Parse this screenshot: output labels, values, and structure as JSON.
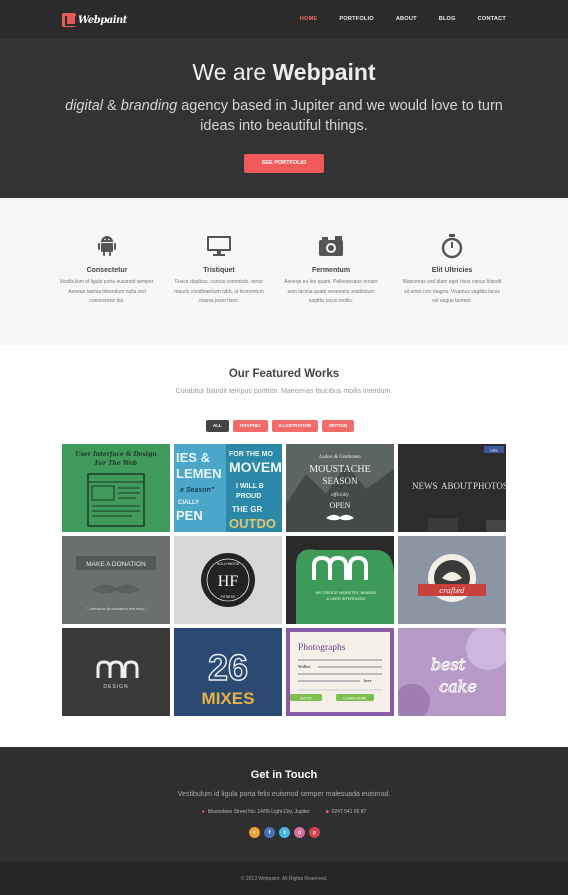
{
  "nav": {
    "logo_text": "Webpaint",
    "items": [
      {
        "label": "HOME",
        "active": true
      },
      {
        "label": "PORTFOLIO",
        "active": false
      },
      {
        "label": "ABOUT",
        "active": false
      },
      {
        "label": "BLOG",
        "active": false
      },
      {
        "label": "CONTACT",
        "active": false
      }
    ]
  },
  "hero": {
    "title_prefix": "We are ",
    "title_brand": "Webpaint",
    "tag_italic1": "digital",
    "tag_amp": " & ",
    "tag_italic2": "branding",
    "tag_rest": " agency based in Jupiter and we would love to turn ideas into beautiful things.",
    "button": "SEE PORTFOLIO"
  },
  "features": [
    {
      "icon": "android-icon",
      "title": "Consectetur",
      "text": "Vestibulum id ligula porta euismod semper. Aenean lacinia bibendum nulla sed consectetur dui."
    },
    {
      "icon": "monitor-icon",
      "title": "Tristiquet",
      "text": "Fusce dapibus, cursus commodo, tortor mauris condimentum nibh, ut fermentum massa justo risus."
    },
    {
      "icon": "camera-icon",
      "title": "Fermentum",
      "text": "Aenean eu leo quam. Pellentesque ornare sem lacinia quam venenatis vestibulum sagittis lacus mollis."
    },
    {
      "icon": "stopwatch-icon",
      "title": "Elit Ultricies",
      "text": "Maecenas sed diam eget risus varius blandit sit amet non magna. Vivamus sagittis lacus vel augue laoreet."
    }
  ],
  "works": {
    "title": "Our Featured Works",
    "subtitle": "Curabitur blandit tempus porttitor. Maecenas faucibus mollis interdum.",
    "filters": [
      {
        "label": "ALL",
        "active": true
      },
      {
        "label": "GRAPHIC",
        "active": false
      },
      {
        "label": "ILLUSTRATION",
        "active": false
      },
      {
        "label": "MOTION",
        "active": false
      }
    ],
    "tiles": {
      "t1": {
        "line1": "User Interface & Design",
        "line2": "For The Web"
      },
      "t2": {
        "a": "IES &",
        "b": "LEMEN",
        "c": "FOR THE MO",
        "d": "MOVEM",
        "e": "e Season\"",
        "f": "I WILL B",
        "g": "PROUD",
        "h": "CIALLY",
        "i": "PEN",
        "j": "THE GR",
        "k": "OUTDO"
      },
      "t3": {
        "a": "Ladies & Gentlemen",
        "b": "MOUSTACHE",
        "c": "SEASON",
        "d": "officially",
        "e": "OPEN"
      },
      "t4": {
        "a": "NEWS",
        "b": "ABOUT",
        "c": "PHOTOS",
        "d": "Like"
      },
      "t5": {
        "a": "MAKE A DONATION",
        "b": "\"...because lip-sweaters are sexy.\""
      },
      "t6": {
        "a": "HF",
        "b": "HOLLYWOOD",
        "c": "FITNESS"
      },
      "t7": {
        "a": "WE CREATE WEBSITES, BRANDS",
        "b": "& USER INTERFACES"
      },
      "t8": {
        "a": "crafted"
      },
      "t9": {
        "a": "DESIGN"
      },
      "t10": {
        "a": "26",
        "b": "MIXES"
      },
      "t11": {
        "a": "Photographs",
        "b": "Walker",
        "c": "here",
        "d": "ARTIST",
        "e": "LEARN MORE"
      },
      "t12": {
        "a": "best",
        "b": "cake"
      }
    }
  },
  "contact": {
    "title": "Get in Touch",
    "subtitle": "Vestibulum id ligula porta felis euismod semper malesuada euismod.",
    "address": "Moonshine Street No: 14/05 Light City, Jupiter",
    "phone": "0247 541 65 87",
    "socials": [
      {
        "name": "rss-icon",
        "color": "#f0a23a",
        "glyph": "r"
      },
      {
        "name": "facebook-icon",
        "color": "#4a72b8",
        "glyph": "f"
      },
      {
        "name": "twitter-icon",
        "color": "#49b7e6",
        "glyph": "t"
      },
      {
        "name": "dribbble-icon",
        "color": "#e06a9e",
        "glyph": "d"
      },
      {
        "name": "pinterest-icon",
        "color": "#d9414b",
        "glyph": "p"
      }
    ]
  },
  "footer": {
    "copyright": "© 2013 Webpaint. All Rights Reserved."
  },
  "colors": {
    "accent": "#f26b6b",
    "dark": "#333333"
  }
}
